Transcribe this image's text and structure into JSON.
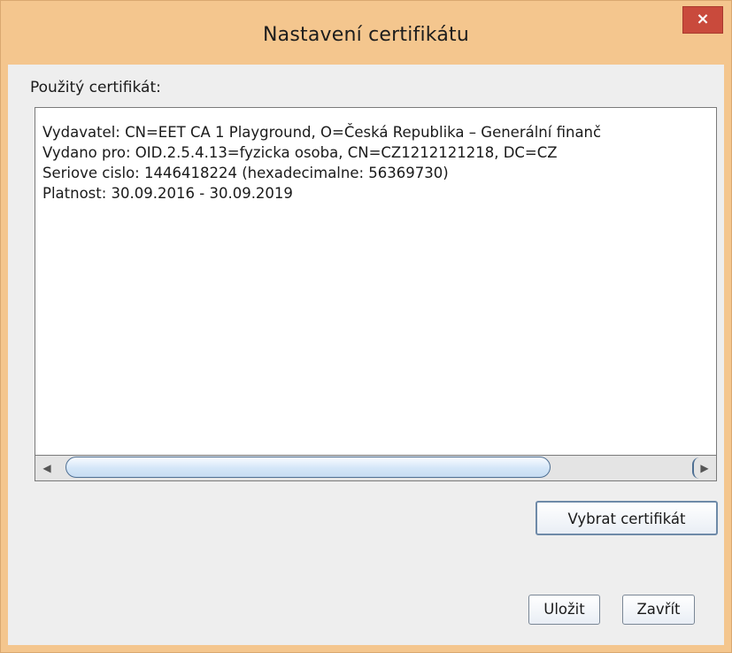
{
  "window": {
    "title": "Nastavení certifikátu",
    "close_glyph": "×"
  },
  "certificate": {
    "label": "Použitý certifikát:",
    "lines": [
      "Vydavatel: CN=EET CA 1 Playground, O=Česká Republika – Generální finanč",
      "Vydano pro: OID.2.5.4.13=fyzicka osoba, CN=CZ1212121218, DC=CZ",
      "Seriove cislo: 1446418224 (hexadecimalne: 56369730)",
      "Platnost: 30.09.2016 - 30.09.2019"
    ]
  },
  "scrollbar": {
    "left_arrow": "◀",
    "right_arrow": "▶"
  },
  "buttons": {
    "select": "Vybrat certifikát",
    "save": "Uložit",
    "close": "Zavřít"
  },
  "colors": {
    "title_bar": "#f4c68e",
    "close_button": "#c94a3c",
    "dialog_background": "#eeeeee",
    "scroll_thumb": "#d4e6f8"
  }
}
